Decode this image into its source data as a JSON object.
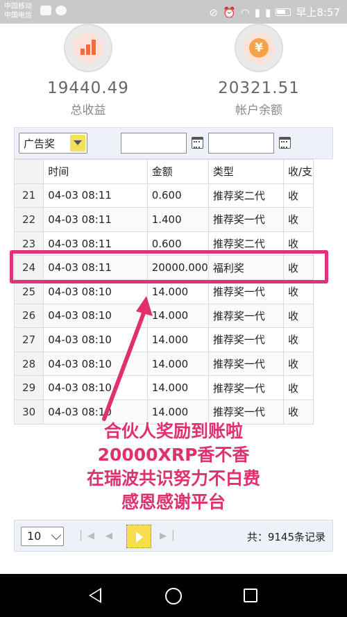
{
  "status_bar": {
    "carrier1": "中国移动",
    "carrier2": "中国电信",
    "time": "早上8:57"
  },
  "summary": {
    "total_income": {
      "value": "19440.49",
      "label": "总收益",
      "icon": "bar-chart-icon"
    },
    "balance": {
      "value": "20321.51",
      "label": "帐户余额",
      "icon": "yen-coin-icon"
    }
  },
  "filter": {
    "type_selected": "广告奖",
    "start_date": "",
    "end_date": ""
  },
  "table": {
    "headers": [
      "时间",
      "金额",
      "类型",
      "收/支"
    ],
    "rows": [
      [
        "21",
        "04-03 08:11",
        "0.600",
        "推荐奖二代",
        "收"
      ],
      [
        "22",
        "04-03 08:11",
        "1.400",
        "推荐奖一代",
        "收"
      ],
      [
        "23",
        "04-03 08:11",
        "0.600",
        "推荐奖二代",
        "收"
      ],
      [
        "24",
        "04-03 08:11",
        "20000.000",
        "福利奖",
        "收"
      ],
      [
        "25",
        "04-03 08:10",
        "14.000",
        "推荐奖一代",
        "收"
      ],
      [
        "26",
        "04-03 08:10",
        "14.000",
        "推荐奖一代",
        "收"
      ],
      [
        "27",
        "04-03 08:10",
        "14.000",
        "推荐奖一代",
        "收"
      ],
      [
        "28",
        "04-03 08:10",
        "14.000",
        "推荐奖一代",
        "收"
      ],
      [
        "29",
        "04-03 08:10",
        "14.000",
        "推荐奖一代",
        "收"
      ],
      [
        "30",
        "04-03 08:10",
        "14.000",
        "推荐奖一代",
        "收"
      ]
    ]
  },
  "annotation": {
    "lines": [
      "合伙人奖励到账啦",
      "20000XRP香不香",
      "在瑞波共识努力不白费",
      "感恩感谢平台"
    ],
    "color": "#e1306f"
  },
  "pager": {
    "page_size": "10",
    "total": "共：9145条记录"
  }
}
